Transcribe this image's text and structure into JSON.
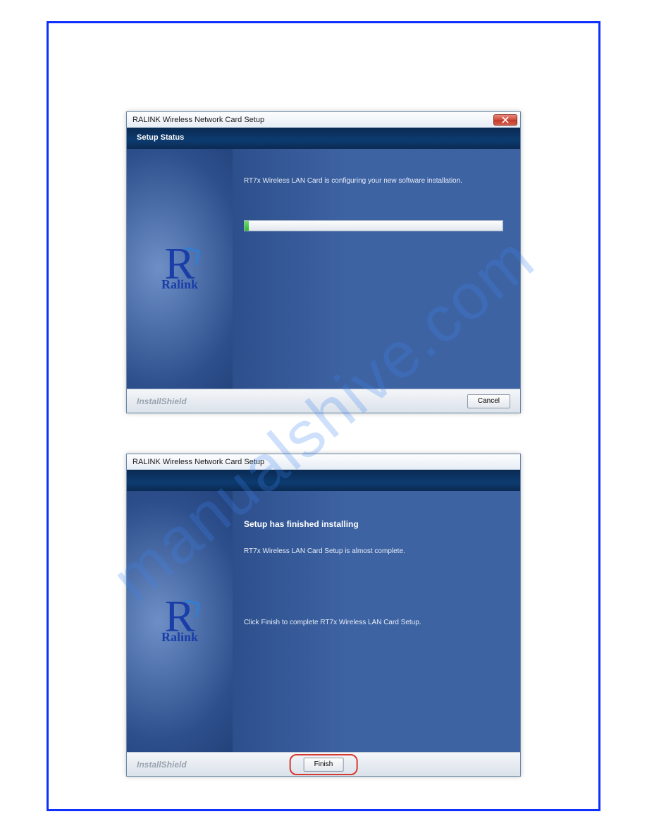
{
  "watermark": "manualshive.com",
  "logo_brand": "Ralink",
  "dialog1": {
    "title": "RALINK Wireless Network Card Setup",
    "header": "Setup Status",
    "status_message": "RT7x Wireless LAN Card is configuring your new software installation.",
    "footer_brand": "InstallShield",
    "cancel_label": "Cancel"
  },
  "dialog2": {
    "title": "RALINK Wireless Network Card Setup",
    "finish_heading": "Setup has finished installing",
    "finish_line1": "RT7x Wireless LAN Card Setup is almost complete.",
    "finish_line2": "Click Finish to complete RT7x Wireless LAN Card Setup.",
    "footer_brand": "InstallShield",
    "finish_label": "Finish"
  }
}
